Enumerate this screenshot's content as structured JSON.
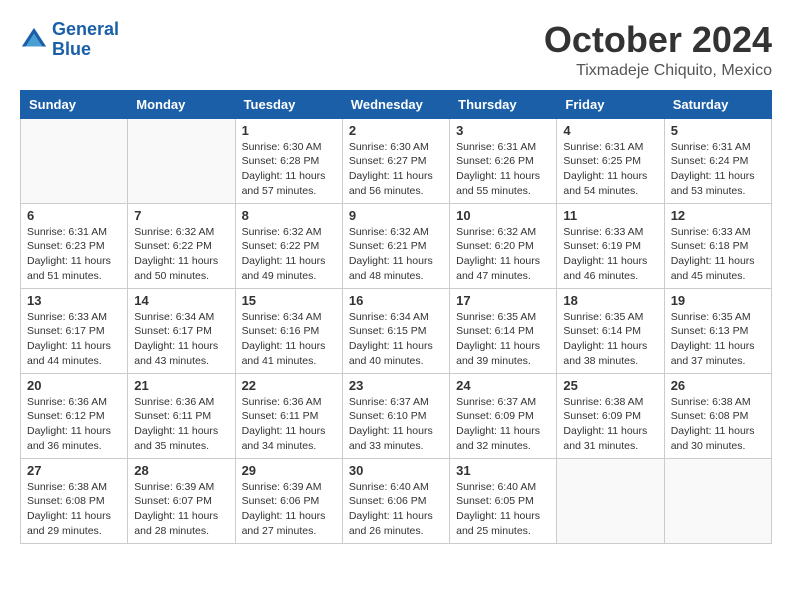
{
  "header": {
    "logo_line1": "General",
    "logo_line2": "Blue",
    "month": "October 2024",
    "location": "Tixmadeje Chiquito, Mexico"
  },
  "days_of_week": [
    "Sunday",
    "Monday",
    "Tuesday",
    "Wednesday",
    "Thursday",
    "Friday",
    "Saturday"
  ],
  "weeks": [
    [
      {
        "day": "",
        "info": ""
      },
      {
        "day": "",
        "info": ""
      },
      {
        "day": "1",
        "info": "Sunrise: 6:30 AM\nSunset: 6:28 PM\nDaylight: 11 hours and 57 minutes."
      },
      {
        "day": "2",
        "info": "Sunrise: 6:30 AM\nSunset: 6:27 PM\nDaylight: 11 hours and 56 minutes."
      },
      {
        "day": "3",
        "info": "Sunrise: 6:31 AM\nSunset: 6:26 PM\nDaylight: 11 hours and 55 minutes."
      },
      {
        "day": "4",
        "info": "Sunrise: 6:31 AM\nSunset: 6:25 PM\nDaylight: 11 hours and 54 minutes."
      },
      {
        "day": "5",
        "info": "Sunrise: 6:31 AM\nSunset: 6:24 PM\nDaylight: 11 hours and 53 minutes."
      }
    ],
    [
      {
        "day": "6",
        "info": "Sunrise: 6:31 AM\nSunset: 6:23 PM\nDaylight: 11 hours and 51 minutes."
      },
      {
        "day": "7",
        "info": "Sunrise: 6:32 AM\nSunset: 6:22 PM\nDaylight: 11 hours and 50 minutes."
      },
      {
        "day": "8",
        "info": "Sunrise: 6:32 AM\nSunset: 6:22 PM\nDaylight: 11 hours and 49 minutes."
      },
      {
        "day": "9",
        "info": "Sunrise: 6:32 AM\nSunset: 6:21 PM\nDaylight: 11 hours and 48 minutes."
      },
      {
        "day": "10",
        "info": "Sunrise: 6:32 AM\nSunset: 6:20 PM\nDaylight: 11 hours and 47 minutes."
      },
      {
        "day": "11",
        "info": "Sunrise: 6:33 AM\nSunset: 6:19 PM\nDaylight: 11 hours and 46 minutes."
      },
      {
        "day": "12",
        "info": "Sunrise: 6:33 AM\nSunset: 6:18 PM\nDaylight: 11 hours and 45 minutes."
      }
    ],
    [
      {
        "day": "13",
        "info": "Sunrise: 6:33 AM\nSunset: 6:17 PM\nDaylight: 11 hours and 44 minutes."
      },
      {
        "day": "14",
        "info": "Sunrise: 6:34 AM\nSunset: 6:17 PM\nDaylight: 11 hours and 43 minutes."
      },
      {
        "day": "15",
        "info": "Sunrise: 6:34 AM\nSunset: 6:16 PM\nDaylight: 11 hours and 41 minutes."
      },
      {
        "day": "16",
        "info": "Sunrise: 6:34 AM\nSunset: 6:15 PM\nDaylight: 11 hours and 40 minutes."
      },
      {
        "day": "17",
        "info": "Sunrise: 6:35 AM\nSunset: 6:14 PM\nDaylight: 11 hours and 39 minutes."
      },
      {
        "day": "18",
        "info": "Sunrise: 6:35 AM\nSunset: 6:14 PM\nDaylight: 11 hours and 38 minutes."
      },
      {
        "day": "19",
        "info": "Sunrise: 6:35 AM\nSunset: 6:13 PM\nDaylight: 11 hours and 37 minutes."
      }
    ],
    [
      {
        "day": "20",
        "info": "Sunrise: 6:36 AM\nSunset: 6:12 PM\nDaylight: 11 hours and 36 minutes."
      },
      {
        "day": "21",
        "info": "Sunrise: 6:36 AM\nSunset: 6:11 PM\nDaylight: 11 hours and 35 minutes."
      },
      {
        "day": "22",
        "info": "Sunrise: 6:36 AM\nSunset: 6:11 PM\nDaylight: 11 hours and 34 minutes."
      },
      {
        "day": "23",
        "info": "Sunrise: 6:37 AM\nSunset: 6:10 PM\nDaylight: 11 hours and 33 minutes."
      },
      {
        "day": "24",
        "info": "Sunrise: 6:37 AM\nSunset: 6:09 PM\nDaylight: 11 hours and 32 minutes."
      },
      {
        "day": "25",
        "info": "Sunrise: 6:38 AM\nSunset: 6:09 PM\nDaylight: 11 hours and 31 minutes."
      },
      {
        "day": "26",
        "info": "Sunrise: 6:38 AM\nSunset: 6:08 PM\nDaylight: 11 hours and 30 minutes."
      }
    ],
    [
      {
        "day": "27",
        "info": "Sunrise: 6:38 AM\nSunset: 6:08 PM\nDaylight: 11 hours and 29 minutes."
      },
      {
        "day": "28",
        "info": "Sunrise: 6:39 AM\nSunset: 6:07 PM\nDaylight: 11 hours and 28 minutes."
      },
      {
        "day": "29",
        "info": "Sunrise: 6:39 AM\nSunset: 6:06 PM\nDaylight: 11 hours and 27 minutes."
      },
      {
        "day": "30",
        "info": "Sunrise: 6:40 AM\nSunset: 6:06 PM\nDaylight: 11 hours and 26 minutes."
      },
      {
        "day": "31",
        "info": "Sunrise: 6:40 AM\nSunset: 6:05 PM\nDaylight: 11 hours and 25 minutes."
      },
      {
        "day": "",
        "info": ""
      },
      {
        "day": "",
        "info": ""
      }
    ]
  ]
}
